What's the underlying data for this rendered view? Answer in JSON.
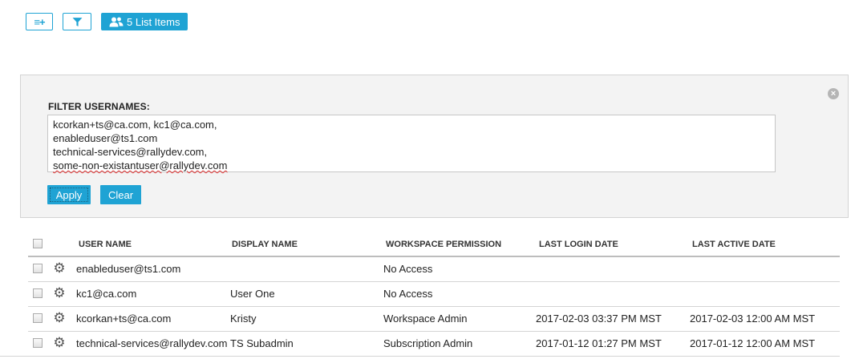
{
  "toolbar": {
    "add_column_glyph": "≡+",
    "filter_icon": "filter-icon",
    "list_items_icon": "users-icon",
    "list_items_label": "5 List Items"
  },
  "filter": {
    "label": "FILTER USERNAMES:",
    "lines": [
      "kcorkan+ts@ca.com, kc1@ca.com,",
      "enableduser@ts1.com",
      "technical-services@rallydev.com,",
      "some-non-existantuser@rallydev.com"
    ],
    "apply_label": "Apply",
    "clear_label": "Clear",
    "close_icon": "close-circle-icon"
  },
  "table": {
    "headers": [
      "USER NAME",
      "DISPLAY NAME",
      "WORKSPACE PERMISSION",
      "LAST LOGIN DATE",
      "LAST ACTIVE DATE"
    ],
    "rows": [
      {
        "user": "enableduser@ts1.com",
        "display": "",
        "permission": "No Access",
        "last_login": "",
        "last_active": ""
      },
      {
        "user": "kc1@ca.com",
        "display": "User One",
        "permission": "No Access",
        "last_login": "",
        "last_active": ""
      },
      {
        "user": "kcorkan+ts@ca.com",
        "display": "Kristy",
        "permission": "Workspace Admin",
        "last_login": "2017-02-03 03:37 PM MST",
        "last_active": "2017-02-03 12:00 AM MST"
      },
      {
        "user": "technical-services@rallydev.com",
        "display": "TS Subadmin",
        "permission": "Subscription Admin",
        "last_login": "2017-01-12 01:27 PM MST",
        "last_active": "2017-01-12 12:00 AM MST"
      }
    ]
  },
  "colors": {
    "accent": "#1fa3d4",
    "panel_bg": "#f3f3f3"
  }
}
